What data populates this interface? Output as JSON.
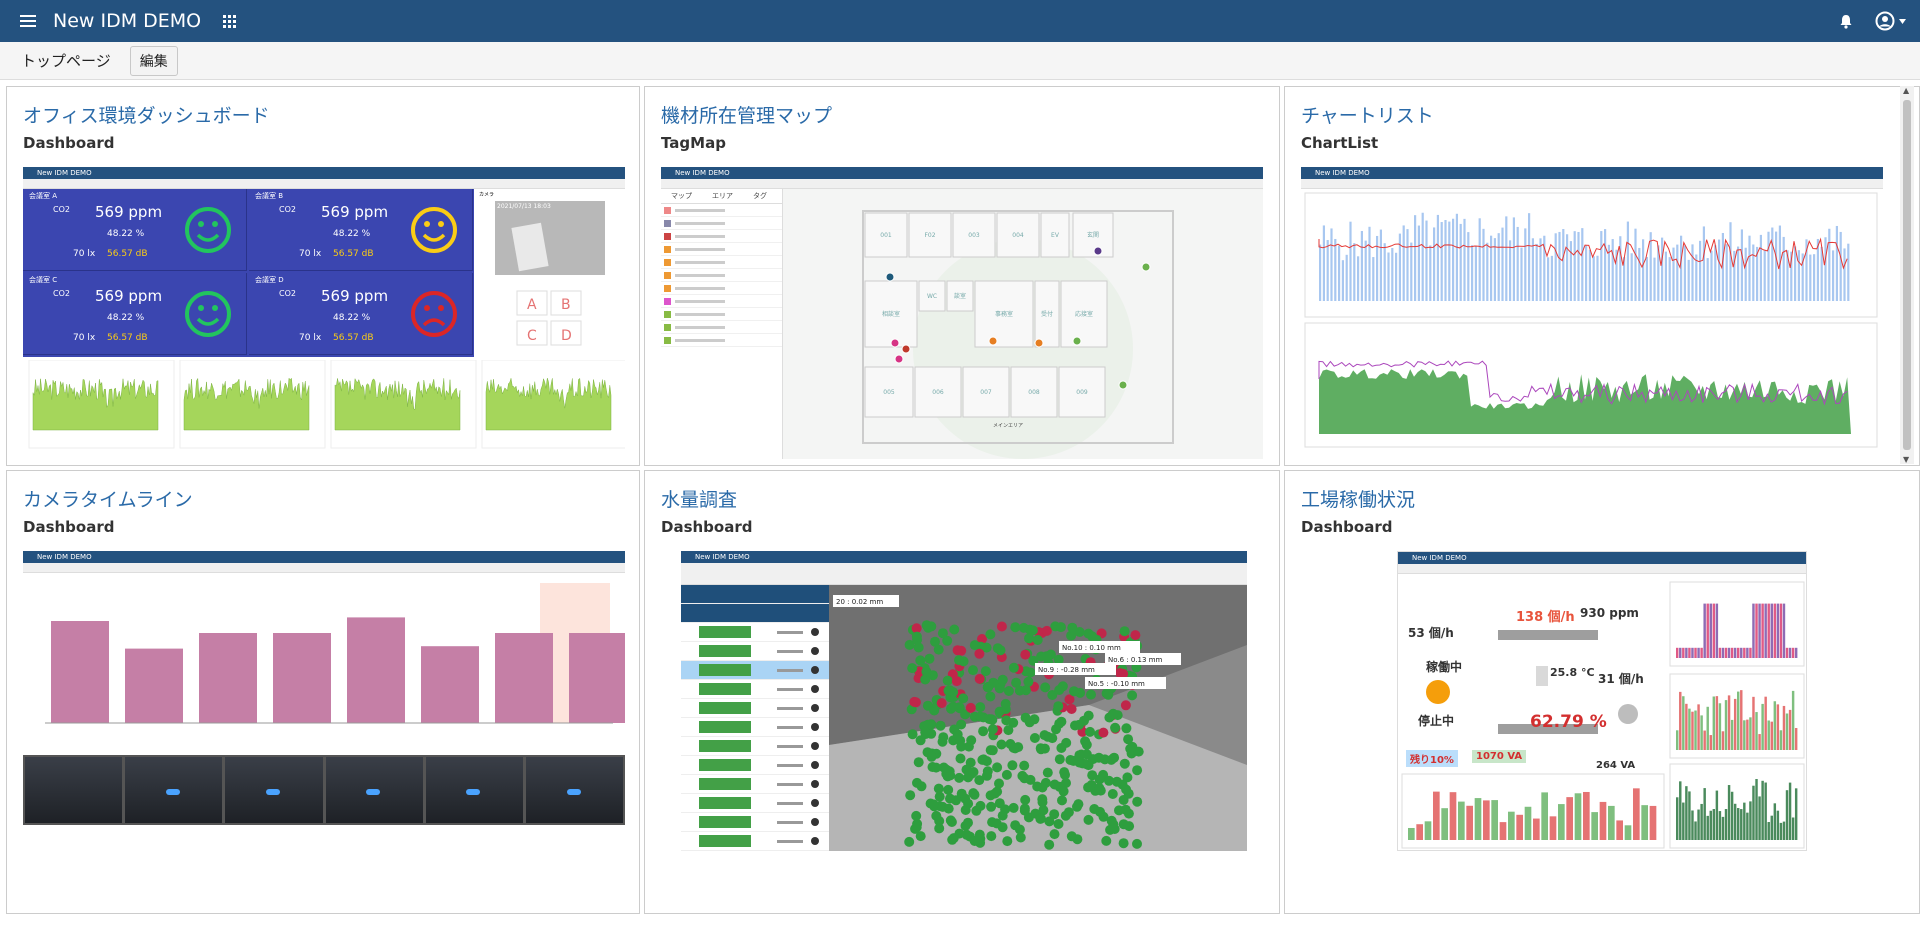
{
  "app": {
    "title": "New IDM DEMO"
  },
  "breadcrumb": {
    "home": "トップページ",
    "edit": "編集"
  },
  "cards": [
    {
      "title": "オフィス環境ダッシュボード",
      "type": "Dashboard"
    },
    {
      "title": "機材所在管理マップ",
      "type": "TagMap"
    },
    {
      "title": "チャートリスト",
      "type": "ChartList"
    },
    {
      "title": "カメラタイムライン",
      "type": "Dashboard"
    },
    {
      "title": "水量調査",
      "type": "Dashboard"
    },
    {
      "title": "工場稼働状況",
      "type": "Dashboard"
    }
  ],
  "office": {
    "rooms": [
      {
        "name": "会議室 A",
        "co2": "569 ppm",
        "hum": "48.22 %",
        "lux": "70 lx",
        "db": "56.57 dB",
        "face": "green"
      },
      {
        "name": "会議室 B",
        "co2": "569 ppm",
        "hum": "48.22 %",
        "lux": "70 lx",
        "db": "56.57 dB",
        "face": "yellow"
      },
      {
        "name": "会議室 C",
        "co2": "569 ppm",
        "hum": "48.22 %",
        "lux": "70 lx",
        "db": "56.57 dB",
        "face": "green"
      },
      {
        "name": "会議室 D",
        "co2": "569 ppm",
        "hum": "48.22 %",
        "lux": "70 lx",
        "db": "56.57 dB",
        "face": "red"
      }
    ],
    "co2_label": "CO2",
    "camera_time": "2021/07/13 18:03"
  },
  "tagmap": {
    "tabs": [
      "マップ",
      "エリア",
      "タグ"
    ],
    "rooms": [
      "001",
      "F02",
      "003",
      "004",
      "EV",
      "玄関",
      "相談室",
      "WC",
      "談室",
      "事務室",
      "受付",
      "応接室",
      "005",
      "006",
      "007",
      "008",
      "009"
    ],
    "area_label": "メインエリア"
  },
  "water": {
    "labels": [
      "20 : 0.02 mm",
      "No.10 : 0.10 mm",
      "No.6 : 0.13 mm",
      "No.9 : -0.28 mm",
      "No.5 : -0.10 mm"
    ]
  },
  "factory": {
    "rate": "138 個/h",
    "ppm": "930 ppm",
    "rate2": "53 個/h",
    "rate3": "31 個/h",
    "status_run": "稼働中",
    "status_stop": "停止中",
    "temp": "25.8 °C",
    "percent": "62.79 %",
    "ratio": "残り10%",
    "va": "1070 VA",
    "va2": "264 VA"
  },
  "colors": {
    "brand": "#24527f",
    "link": "#2a6aa8"
  }
}
